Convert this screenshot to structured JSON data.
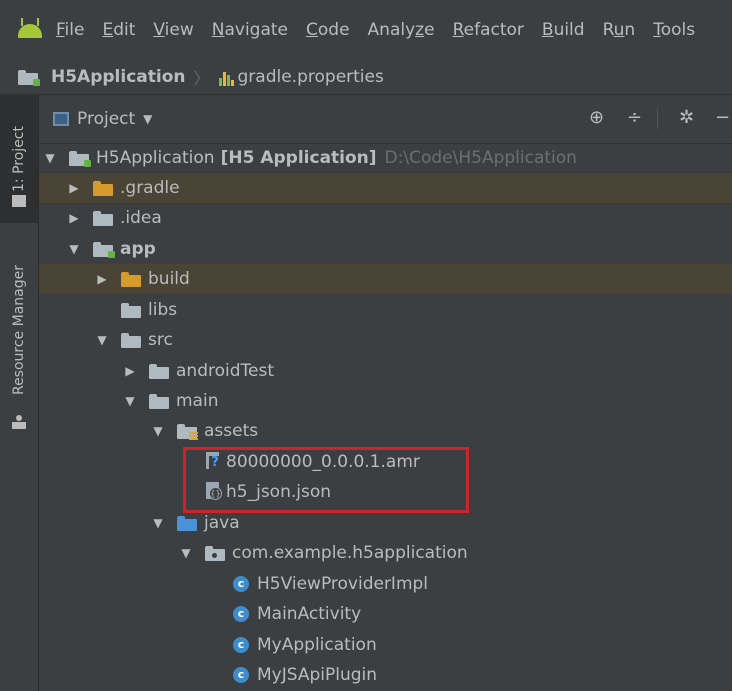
{
  "menubar": {
    "items": [
      {
        "pre": "",
        "u": "F",
        "post": "ile"
      },
      {
        "pre": "",
        "u": "E",
        "post": "dit"
      },
      {
        "pre": "",
        "u": "V",
        "post": "iew"
      },
      {
        "pre": "",
        "u": "N",
        "post": "avigate"
      },
      {
        "pre": "",
        "u": "C",
        "post": "ode"
      },
      {
        "pre": "Analy",
        "u": "z",
        "post": "e"
      },
      {
        "pre": "",
        "u": "R",
        "post": "efactor"
      },
      {
        "pre": "",
        "u": "B",
        "post": "uild"
      },
      {
        "pre": "R",
        "u": "u",
        "post": "n"
      },
      {
        "pre": "",
        "u": "T",
        "post": "ools"
      }
    ]
  },
  "breadcrumb": {
    "project": "H5Application",
    "separator": "〉",
    "file": "gradle.properties"
  },
  "left_strip": {
    "project_tab": "1: Project",
    "resource_tab": "Resource Manager"
  },
  "panel": {
    "title": "Project",
    "caret": "▼",
    "icons": {
      "locate": "⊕",
      "collapse": "÷",
      "settings": "✲",
      "minimize": "−"
    }
  },
  "tree": {
    "root": {
      "name": "H5Application",
      "module": "[H5 Application]",
      "path": "D:\\Code\\H5Application"
    },
    "gradle": ".gradle",
    "idea": ".idea",
    "app": "app",
    "build": "build",
    "libs": "libs",
    "src": "src",
    "androidTest": "androidTest",
    "main": "main",
    "assets": "assets",
    "amr_file": "80000000_0.0.0.1.amr",
    "json_file": "h5_json.json",
    "java": "java",
    "package": "com.example.h5application",
    "classes": [
      "H5ViewProviderImpl",
      "MainActivity",
      "MyApplication",
      "MyJSApiPlugin"
    ]
  },
  "glyphs": {
    "expanded": "▼",
    "collapsed": "▶",
    "class_letter": "c"
  },
  "colors": {
    "highlight": "#c8252c",
    "excluded_row": "#494435",
    "android_green": "#a4c639"
  }
}
